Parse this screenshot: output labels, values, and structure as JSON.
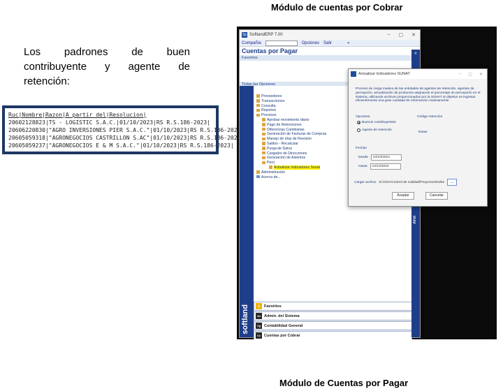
{
  "captions": {
    "top": "Módulo de cuentas por Cobrar",
    "bottom": "Módulo de Cuentas por Pagar"
  },
  "intro": {
    "text": "Los padrones de buen contribuyente y agente de retención:"
  },
  "code_listing": {
    "header": "Ruc|Nombre|Razon|A partir del|Resolucion|",
    "rows": [
      "20602128823|TS - LOGISTIC S.A.C.|01/10/2023|RS R.S.186-2023|",
      "20606220830|\"AGRO INVERSIONES PIER S.A.C.\"|01/10/2023|RS R.S.186-2023|",
      "20605059318|\"AGRONEGOCIOS CASTRILLON S.AC\"|01/10/2023|RS R.S.186-2023|",
      "20605059237|\"AGRONEGOCIOS E & M S.A.C.\"|01/10/2023|RS R.S.186-2023|"
    ]
  },
  "app": {
    "window_title": "SoftlandERP 7.00",
    "menu": [
      "Compañía",
      "Opciones",
      "Salir"
    ],
    "menu_more": "»",
    "panel_title": "Cuentas por Pagar",
    "favoritos_bar": "Favoritos",
    "tree_header": "Todas las Opciones",
    "collapse_glyph": "«",
    "tree": [
      {
        "label": "Proveedores",
        "indent": 0
      },
      {
        "label": "Transacciones",
        "indent": 0
      },
      {
        "label": "Consulta",
        "indent": 0
      },
      {
        "label": "Reportes",
        "indent": 0
      },
      {
        "label": "Procesos",
        "indent": 0
      },
      {
        "label": "Aprobar movimiento diario",
        "indent": 1
      },
      {
        "label": "Pago de Retenciones",
        "indent": 1
      },
      {
        "label": "Diferencias Cambiarias",
        "indent": 1
      },
      {
        "label": "Generación de Facturas de Compras",
        "indent": 1
      },
      {
        "label": "Manejo de días de Revisión",
        "indent": 1
      },
      {
        "label": "Saldos - Recalcular",
        "indent": 1
      },
      {
        "label": "Purga de Datos",
        "indent": 1
      },
      {
        "label": "Cargador de Direcciones",
        "indent": 1
      },
      {
        "label": "Generación de Asientos",
        "indent": 1
      },
      {
        "label": "Perú",
        "indent": 1
      },
      {
        "label": "Actualizar Indicadores Sunat",
        "indent": 2,
        "highlight": true
      },
      {
        "label": "Administración",
        "indent": 0
      },
      {
        "label": "Acerca de...",
        "indent": 0
      }
    ],
    "brand": "softland",
    "right_strip_label": "Arvi",
    "nav_items": [
      {
        "icon": "★",
        "label": "Favoritos"
      },
      {
        "icon": "As",
        "label": "Admin. del Sistema"
      },
      {
        "icon": "Cg",
        "label": "Contabilidad General"
      },
      {
        "icon": "Cc",
        "label": "Cuentas por Cobrar"
      }
    ]
  },
  "dialog": {
    "title": "Actualizar Indicadores SUNAT",
    "description": "Proceso de carga masiva de las entidades de agentes de retención, agentes de percepción, actualización de productos asignando el porcentaje de percepción en el sistema, utilizando archivos proporcionados por la SUNAT al objetivo es ingresar eficientemente una gran cantidad de información masivamente",
    "options_label": "Opciones",
    "retention_code_label": "Código retención",
    "options": [
      {
        "label": "Buenos contribuyentes",
        "selected": true
      },
      {
        "label": "Agente de retención",
        "selected": false
      }
    ],
    "notes_label": "Notas",
    "dates_label": "Fechas",
    "desde_label": "Desde",
    "desde_value": "24/10/2024",
    "hasta_label": "Hasta",
    "hasta_value": "24/10/2024",
    "load_file_label": "Cargar archivo",
    "file_path": "D:\\CDC\\Control de Calidad\\Proyectos\\Indira",
    "browse_label": "...",
    "accept_label": "Aceptar",
    "cancel_label": "Cancelar"
  }
}
